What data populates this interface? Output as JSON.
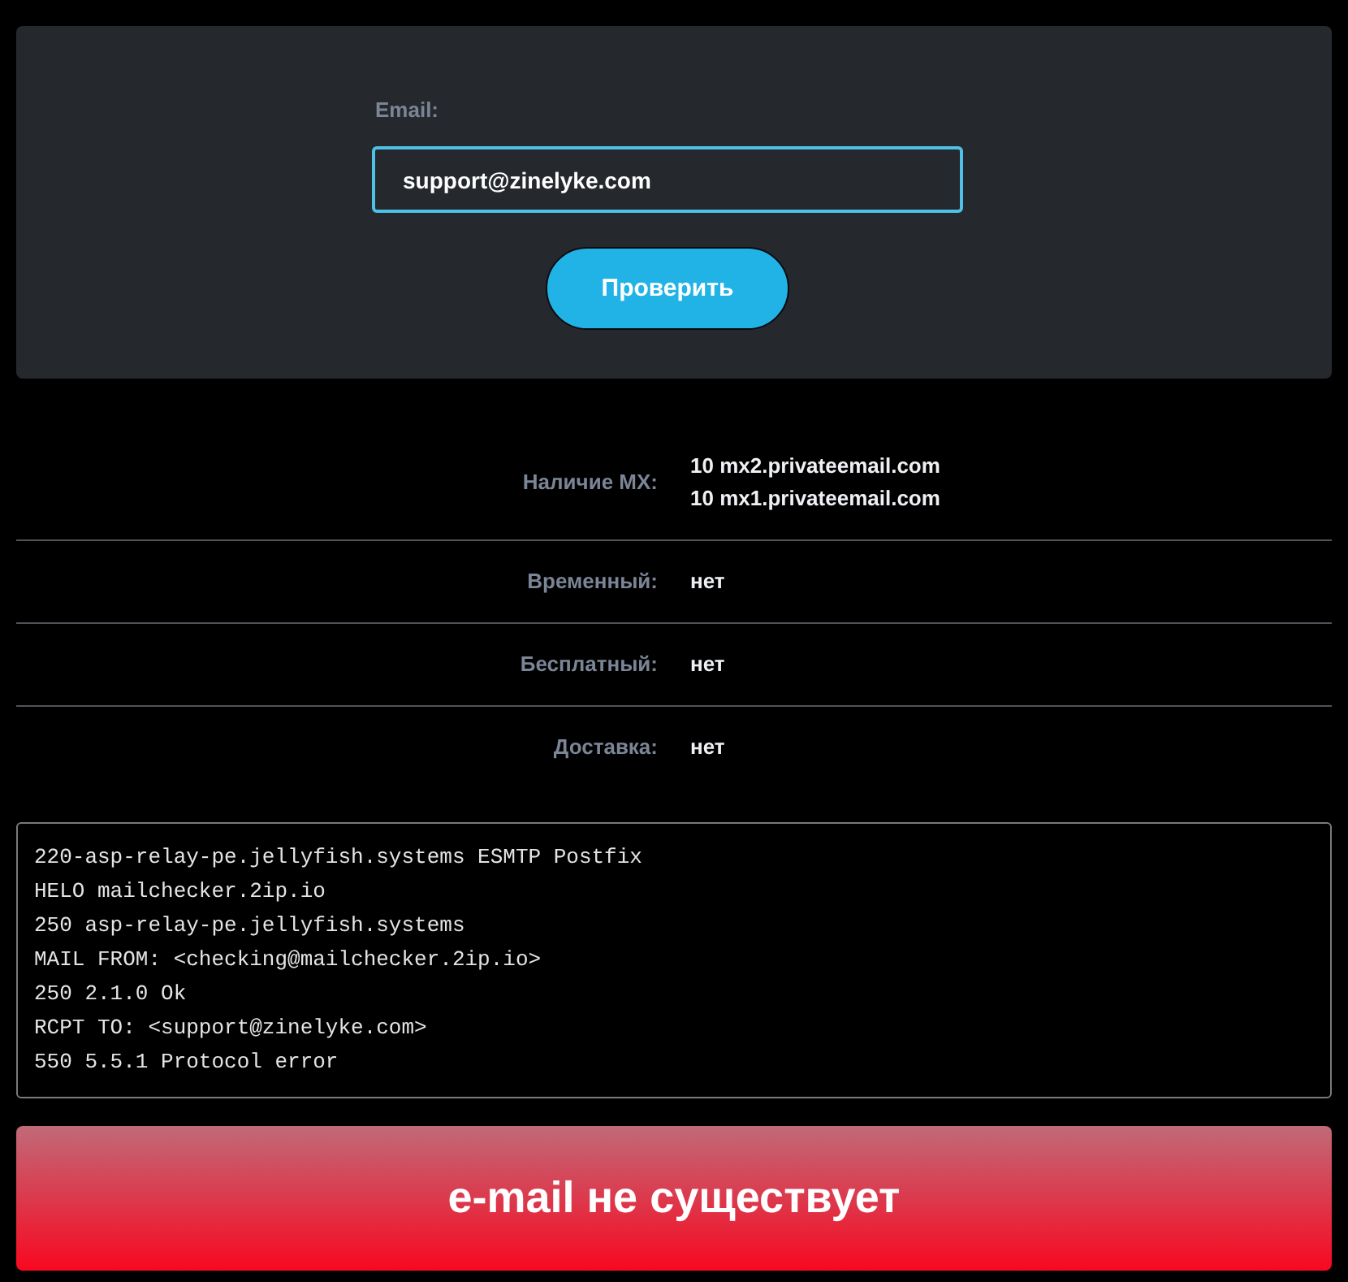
{
  "form": {
    "label": "Email:",
    "value": "support@zinelyke.com",
    "button": "Проверить"
  },
  "results": [
    {
      "label": "Наличие MX:",
      "values": [
        "10 mx2.privateemail.com",
        "10 mx1.privateemail.com"
      ]
    },
    {
      "label": "Временный:",
      "values": [
        "нет"
      ]
    },
    {
      "label": "Бесплатный:",
      "values": [
        "нет"
      ]
    },
    {
      "label": "Доставка:",
      "values": [
        "нет"
      ]
    }
  ],
  "log": [
    "220-asp-relay-pe.jellyfish.systems ESMTP Postfix",
    "HELO mailchecker.2ip.io",
    "250 asp-relay-pe.jellyfish.systems",
    "MAIL FROM: <checking@mailchecker.2ip.io>",
    "250 2.1.0 Ok",
    "RCPT TO: <support@zinelyke.com>",
    "550 5.5.1 Protocol error"
  ],
  "verdict": {
    "text": "e-mail не существует",
    "valid": false
  }
}
